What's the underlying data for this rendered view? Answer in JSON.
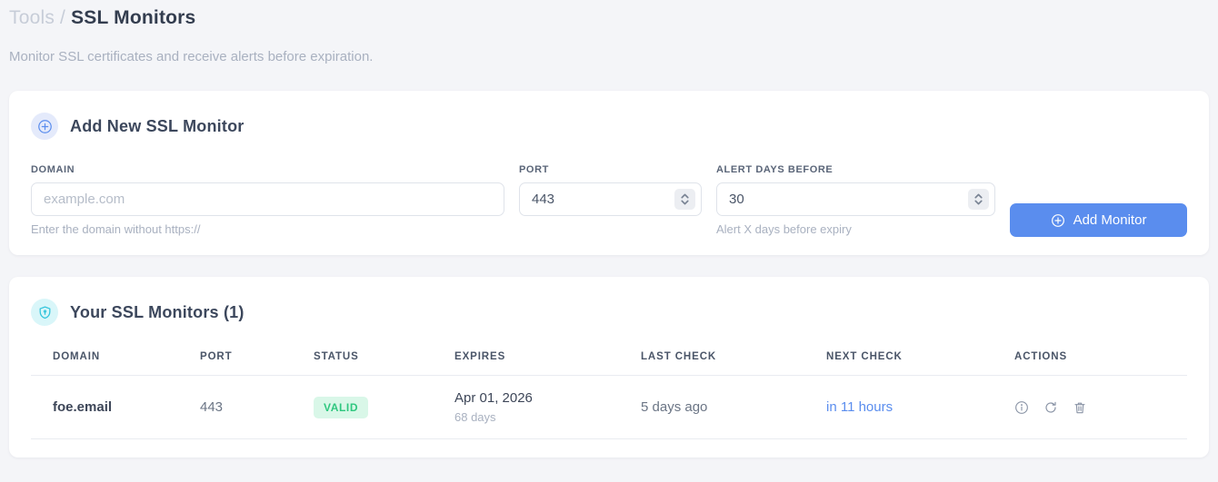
{
  "page": {
    "breadcrumb": {
      "section": "Tools",
      "separator": "/",
      "current": "SSL Monitors"
    },
    "subtitle": "Monitor SSL certificates and receive alerts before expiration."
  },
  "add_monitor_card": {
    "title": "Add New SSL Monitor",
    "header_icon": "plus-circle-icon",
    "fields": {
      "domain": {
        "label": "DOMAIN",
        "placeholder": "example.com",
        "value": "",
        "helper": "Enter the domain without https://"
      },
      "port": {
        "label": "PORT",
        "value": "443"
      },
      "alert_days": {
        "label": "ALERT DAYS BEFORE",
        "value": "30",
        "helper": "Alert X days before expiry"
      }
    },
    "submit_label": "Add Monitor",
    "submit_icon": "plus-circle-icon"
  },
  "monitors_card": {
    "title": "Your SSL Monitors (1)",
    "header_icon": "shield-icon",
    "table": {
      "headers": [
        "DOMAIN",
        "PORT",
        "STATUS",
        "EXPIRES",
        "LAST CHECK",
        "NEXT CHECK",
        "ACTIONS"
      ],
      "rows": [
        {
          "domain": "foe.email",
          "port": "443",
          "status": "VALID",
          "expires_date": "Apr 01, 2026",
          "expires_days": "68 days",
          "last_check": "5 days ago",
          "next_check": "in 11 hours",
          "action_icons": [
            "info-icon",
            "refresh-icon",
            "trash-icon"
          ]
        }
      ]
    }
  },
  "colors": {
    "accent_blue": "#5a8dee",
    "accent_cyan": "#35c5dc",
    "valid_green": "#2fc77f",
    "valid_green_bg": "#d9f7e8",
    "page_bg": "#f4f5f8"
  }
}
